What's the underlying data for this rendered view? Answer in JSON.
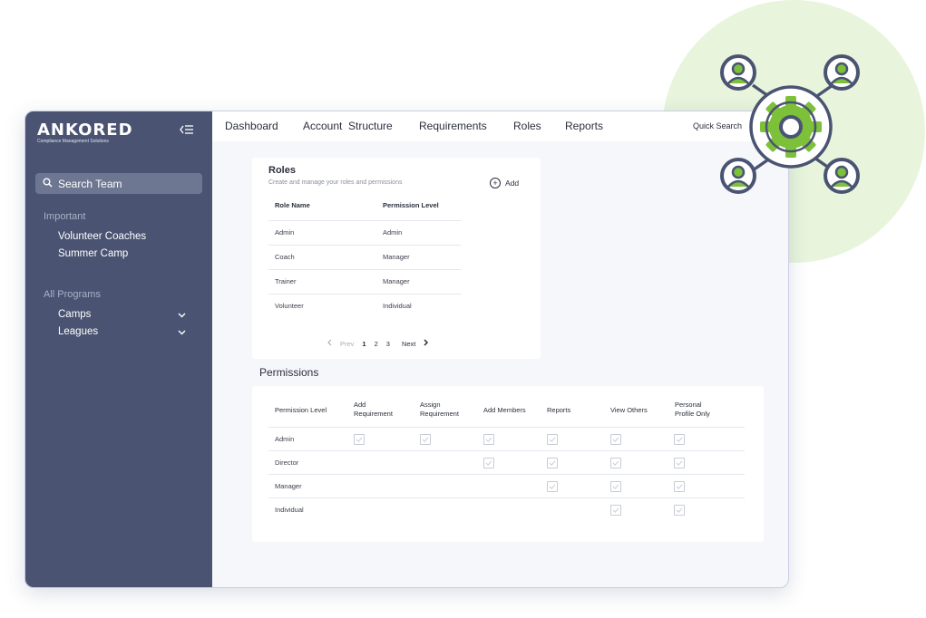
{
  "brand": {
    "name": "ANKORED",
    "tagline": "Compliance Management Solutions"
  },
  "sidebar": {
    "search_label": "Search Team",
    "important_heading": "Important",
    "important_items": [
      "Volunteer Coaches",
      "Summer Camp"
    ],
    "programs_heading": "All Programs",
    "program_items": [
      "Camps",
      "Leagues"
    ]
  },
  "topnav": {
    "items": [
      "Dashboard",
      "Account  Structure",
      "Requirements",
      "Roles",
      "Reports"
    ],
    "quick_search": "Quick Search"
  },
  "roles": {
    "title": "Roles",
    "subtitle": "Create and manage your roles and permissions",
    "add_label": "Add",
    "columns": [
      "Role Name",
      "Permission Level"
    ],
    "rows": [
      [
        "Admin",
        "Admin"
      ],
      [
        "Coach",
        "Manager"
      ],
      [
        "Trainer",
        "Manager"
      ],
      [
        "Volunteer",
        "Individual"
      ]
    ],
    "pagination": {
      "prev": "Prev",
      "pages": [
        "1",
        "2",
        "3"
      ],
      "current": "1",
      "next": "Next"
    }
  },
  "permissions": {
    "title": "Permissions",
    "columns": [
      "Permission Level",
      "Add Requirement",
      "Assign Requirement",
      "Add Members",
      "Reports",
      "View Others",
      "Personal Profile Only"
    ],
    "rows": [
      {
        "level": "Admin",
        "checks": [
          true,
          true,
          true,
          true,
          true,
          true
        ]
      },
      {
        "level": "Director",
        "checks": [
          false,
          false,
          true,
          true,
          true,
          true
        ]
      },
      {
        "level": "Manager",
        "checks": [
          false,
          false,
          false,
          true,
          true,
          true
        ]
      },
      {
        "level": "Individual",
        "checks": [
          false,
          false,
          false,
          false,
          true,
          true
        ]
      }
    ]
  },
  "colors": {
    "sidebar": "#4a5472",
    "accent_green": "#7dc13a",
    "icon_dark": "#4a5472"
  }
}
